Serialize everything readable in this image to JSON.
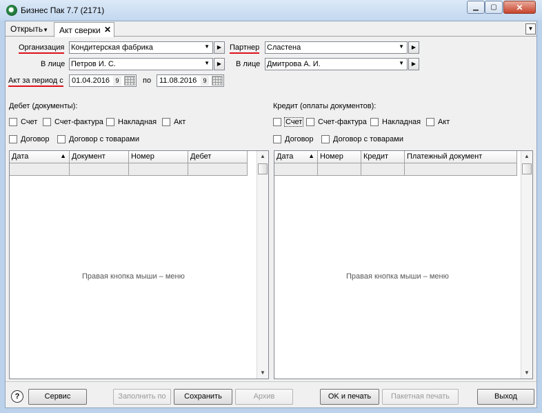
{
  "window": {
    "title": "Бизнес Пак 7.7 (2171)"
  },
  "tabs": {
    "open_menu": "Открыть",
    "active_tab": "Акт сверки"
  },
  "form": {
    "org_label": "Организация",
    "org_value": "Кондитерская фабрика",
    "partner_label": "Партнер",
    "partner_value": "Сластена",
    "person_label": "В лице",
    "org_person_value": "Петров И. С.",
    "partner_person_label": "В лице",
    "partner_person_value": "Дмитрова А. И.",
    "period_label": "Акт за период с",
    "date_from": "01.04.2016",
    "date_from_nine": "9",
    "to_label": "по",
    "date_to": "11.08.2016",
    "date_to_nine": "9"
  },
  "debit": {
    "title": "Дебет (документы):",
    "checkboxes": [
      "Счет",
      "Счет-фактура",
      "Накладная",
      "Акт",
      "Договор",
      "Договор с товарами"
    ],
    "columns": [
      "Дата",
      "Документ",
      "Номер",
      "Дебет"
    ],
    "hint": "Правая кнопка мыши – меню"
  },
  "credit": {
    "title": "Кредит (оплаты документов):",
    "checkboxes": [
      "Счет",
      "Счет-фактура",
      "Накладная",
      "Акт",
      "Договор",
      "Договор с товарами"
    ],
    "columns": [
      "Дата",
      "Номер",
      "Кредит",
      "Платежный документ"
    ],
    "hint": "Правая кнопка мыши – меню"
  },
  "buttons": {
    "help": "?",
    "service": "Сервис",
    "fill": "Заполнить по",
    "save": "Сохранить",
    "archive": "Архив",
    "ok_print": "OK и печать",
    "batch_print": "Пакетная печать",
    "exit": "Выход"
  },
  "colors": {
    "underline_accent": "#e0101a",
    "titlebar": "#c2d7ef"
  }
}
